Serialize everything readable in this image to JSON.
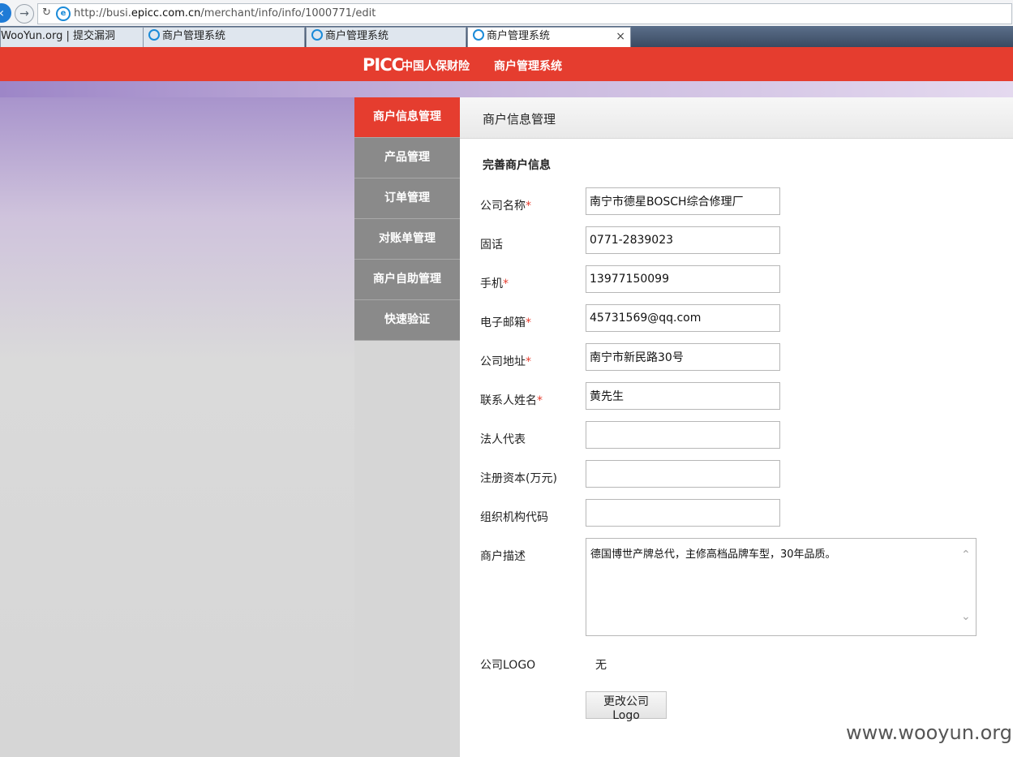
{
  "browser": {
    "url_prefix": "http://busi.",
    "url_domain": "epicc.com.cn",
    "url_path": "/merchant/info/info/1000771/edit",
    "tabs": [
      {
        "label": "WooYun.org | 提交漏洞"
      },
      {
        "label": "商户管理系统"
      },
      {
        "label": "商户管理系统"
      },
      {
        "label": "商户管理系统"
      }
    ],
    "close_glyph": "×"
  },
  "header": {
    "logo_text": "PICC",
    "logo_cn": "中国人保财险",
    "site_title": "商户管理系统"
  },
  "nav": {
    "items": [
      {
        "label": "商户信息管理",
        "active": true
      },
      {
        "label": "产品管理"
      },
      {
        "label": "订单管理"
      },
      {
        "label": "对账单管理"
      },
      {
        "label": "商户自助管理"
      },
      {
        "label": "快速验证"
      }
    ]
  },
  "panel": {
    "title": "商户信息管理",
    "section_title": "完善商户信息"
  },
  "form": {
    "required_mark": "*",
    "company_name": {
      "label": "公司名称",
      "value": "南宁市德星BOSCH综合修理厂"
    },
    "landline": {
      "label": "固话",
      "value": "0771-2839023"
    },
    "mobile": {
      "label": "手机",
      "value": "13977150099"
    },
    "email": {
      "label": "电子邮箱",
      "value": "45731569@qq.com"
    },
    "address": {
      "label": "公司地址",
      "value": "南宁市新民路30号"
    },
    "contact": {
      "label": "联系人姓名",
      "value": "黄先生"
    },
    "legal_rep": {
      "label": "法人代表",
      "value": ""
    },
    "capital": {
      "label": "注册资本(万元)",
      "value": ""
    },
    "org_code": {
      "label": "组织机构代码",
      "value": ""
    },
    "description": {
      "label": "商户描述",
      "value": "德国博世产牌总代，主修高档品牌车型，30年品质。"
    },
    "logo": {
      "label": "公司LOGO",
      "value": "无",
      "button_label": "更改公司Logo"
    }
  },
  "watermark": "www.wooyun.org"
}
